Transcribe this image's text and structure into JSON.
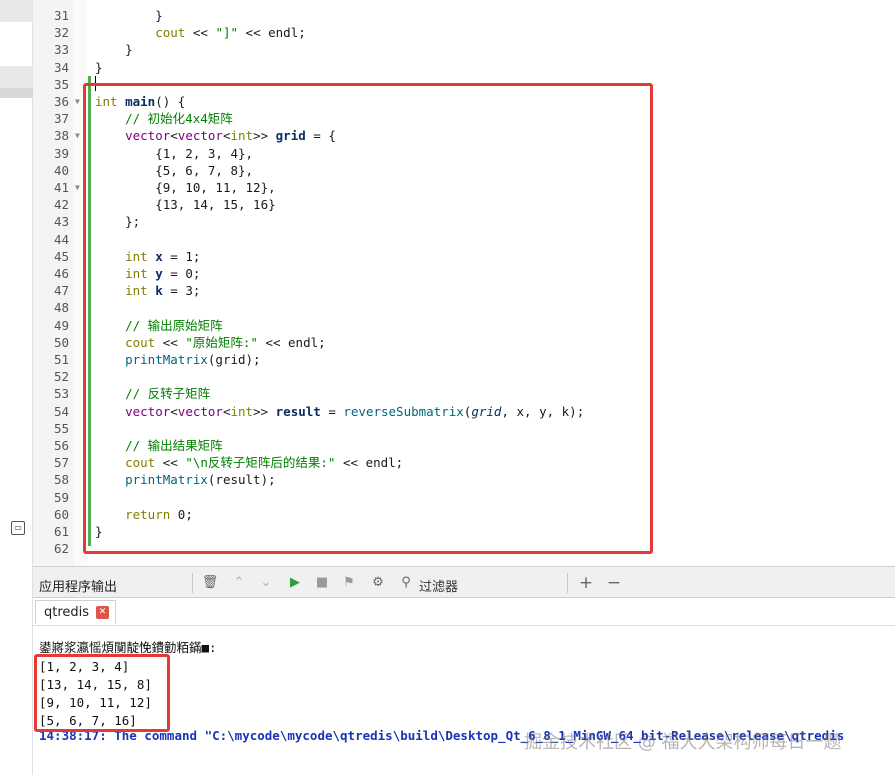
{
  "editor": {
    "lines": [
      {
        "n": "31",
        "parts": [
          [
            "",
            "        }"
          ]
        ]
      },
      {
        "n": "32",
        "parts": [
          [
            "",
            "        "
          ],
          [
            "kw",
            "cout"
          ],
          [
            "",
            " << "
          ],
          [
            "st",
            "\"]\""
          ],
          [
            "",
            " << "
          ],
          [
            "",
            "endl;"
          ]
        ]
      },
      {
        "n": "33",
        "parts": [
          [
            "",
            "    }"
          ]
        ]
      },
      {
        "n": "34",
        "parts": [
          [
            "",
            "}"
          ]
        ]
      },
      {
        "n": "35",
        "parts": [
          [
            "",
            ""
          ]
        ]
      },
      {
        "n": "36",
        "parts": [
          [
            "kw",
            "int"
          ],
          [
            "",
            " "
          ],
          [
            "var",
            "main"
          ],
          [
            "",
            "() {"
          ]
        ]
      },
      {
        "n": "37",
        "parts": [
          [
            "",
            "    "
          ],
          [
            "cm",
            "// 初始化4x4矩阵"
          ]
        ]
      },
      {
        "n": "38",
        "parts": [
          [
            "",
            "    "
          ],
          [
            "ty",
            "vector"
          ],
          [
            "",
            "<"
          ],
          [
            "ty",
            "vector"
          ],
          [
            "",
            "<"
          ],
          [
            "kw",
            "int"
          ],
          [
            "",
            ">> "
          ],
          [
            "var",
            "grid"
          ],
          [
            "",
            " = {"
          ]
        ]
      },
      {
        "n": "39",
        "parts": [
          [
            "",
            "        {"
          ],
          [
            "",
            "1, 2, 3, 4"
          ],
          [
            "",
            "},"
          ]
        ]
      },
      {
        "n": "40",
        "parts": [
          [
            "",
            "        {"
          ],
          [
            "",
            "5, 6, 7, 8"
          ],
          [
            "",
            "},"
          ]
        ]
      },
      {
        "n": "41",
        "parts": [
          [
            "",
            "        {"
          ],
          [
            "",
            "9, 10, 11, 12"
          ],
          [
            "",
            "},"
          ]
        ]
      },
      {
        "n": "42",
        "parts": [
          [
            "",
            "        {"
          ],
          [
            "",
            "13, 14, 15, 16"
          ],
          [
            "",
            "}"
          ]
        ]
      },
      {
        "n": "43",
        "parts": [
          [
            "",
            "    };"
          ]
        ]
      },
      {
        "n": "44",
        "parts": [
          [
            "",
            ""
          ]
        ]
      },
      {
        "n": "45",
        "parts": [
          [
            "",
            "    "
          ],
          [
            "kw",
            "int"
          ],
          [
            "",
            " "
          ],
          [
            "var",
            "x"
          ],
          [
            "",
            " = 1;"
          ]
        ]
      },
      {
        "n": "46",
        "parts": [
          [
            "",
            "    "
          ],
          [
            "kw",
            "int"
          ],
          [
            "",
            " "
          ],
          [
            "var",
            "y"
          ],
          [
            "",
            " = 0;"
          ]
        ]
      },
      {
        "n": "47",
        "parts": [
          [
            "",
            "    "
          ],
          [
            "kw",
            "int"
          ],
          [
            "",
            " "
          ],
          [
            "var",
            "k"
          ],
          [
            "",
            " = 3;"
          ]
        ]
      },
      {
        "n": "48",
        "parts": [
          [
            "",
            ""
          ]
        ]
      },
      {
        "n": "49",
        "parts": [
          [
            "",
            "    "
          ],
          [
            "cm",
            "// 输出原始矩阵"
          ]
        ]
      },
      {
        "n": "50",
        "parts": [
          [
            "",
            "    "
          ],
          [
            "kw",
            "cout"
          ],
          [
            "",
            " << "
          ],
          [
            "st",
            "\"原始矩阵:\""
          ],
          [
            "",
            " << "
          ],
          [
            "",
            "endl;"
          ]
        ]
      },
      {
        "n": "51",
        "parts": [
          [
            "",
            "    "
          ],
          [
            "fn",
            "printMatrix"
          ],
          [
            "",
            "(grid);"
          ]
        ]
      },
      {
        "n": "52",
        "parts": [
          [
            "",
            ""
          ]
        ]
      },
      {
        "n": "53",
        "parts": [
          [
            "",
            "    "
          ],
          [
            "cm",
            "// 反转子矩阵"
          ]
        ]
      },
      {
        "n": "54",
        "parts": [
          [
            "",
            "    "
          ],
          [
            "ty",
            "vector"
          ],
          [
            "",
            "<"
          ],
          [
            "ty",
            "vector"
          ],
          [
            "",
            "<"
          ],
          [
            "kw",
            "int"
          ],
          [
            "",
            ">> "
          ],
          [
            "var",
            "result"
          ],
          [
            "",
            " = "
          ],
          [
            "fn",
            "reverseSubmatrix"
          ],
          [
            "",
            "("
          ],
          [
            "it",
            "grid"
          ],
          [
            "",
            ", x, y, k);"
          ]
        ]
      },
      {
        "n": "55",
        "parts": [
          [
            "",
            ""
          ]
        ]
      },
      {
        "n": "56",
        "parts": [
          [
            "",
            "    "
          ],
          [
            "cm",
            "// 输出结果矩阵"
          ]
        ]
      },
      {
        "n": "57",
        "parts": [
          [
            "",
            "    "
          ],
          [
            "kw",
            "cout"
          ],
          [
            "",
            " << "
          ],
          [
            "st",
            "\"\\n反转子矩阵后的结果:\""
          ],
          [
            "",
            " << "
          ],
          [
            "",
            "endl;"
          ]
        ]
      },
      {
        "n": "58",
        "parts": [
          [
            "",
            "    "
          ],
          [
            "fn",
            "printMatrix"
          ],
          [
            "",
            "(result);"
          ]
        ]
      },
      {
        "n": "59",
        "parts": [
          [
            "",
            ""
          ]
        ]
      },
      {
        "n": "60",
        "parts": [
          [
            "",
            "    "
          ],
          [
            "kw",
            "return"
          ],
          [
            "",
            " 0;"
          ]
        ]
      },
      {
        "n": "61",
        "parts": [
          [
            "",
            "}"
          ]
        ]
      },
      {
        "n": "62",
        "parts": [
          [
            "",
            ""
          ]
        ]
      }
    ],
    "fold_lines": [
      "36",
      "38",
      "41"
    ]
  },
  "output_pane": {
    "title": "应用程序输出",
    "filter_label": "过滤器",
    "tab_label": "qtredis",
    "tab_close": "✕",
    "lines": [
      "鍙嶈浆瀛愮煩闃靛悗鐨勭粨鏋■:",
      "[1, 2, 3, 4]",
      "[13, 14, 15, 8]",
      "[9, 10, 11, 12]",
      "[5, 6, 7, 16]"
    ],
    "status_line": "14:38:17: The command \"C:\\mycode\\mycode\\qtredis\\build\\Desktop_Qt_6_8_1_MinGW_64_bit-Release\\release\\qtredis"
  },
  "toolbar_icons": [
    "trash-icon",
    "arrow-up-icon",
    "arrow-down-icon",
    "run-icon",
    "stop-icon",
    "attach-icon",
    "gear-icon",
    "search-icon",
    "plus-icon",
    "minus-icon"
  ],
  "watermark": "掘金技术社区 @ 福大大架构师每日一题",
  "colors": {
    "highlight_red": "#e53935",
    "keyword": "#808000",
    "comment": "#008000",
    "status_blue": "#1a33b8"
  }
}
